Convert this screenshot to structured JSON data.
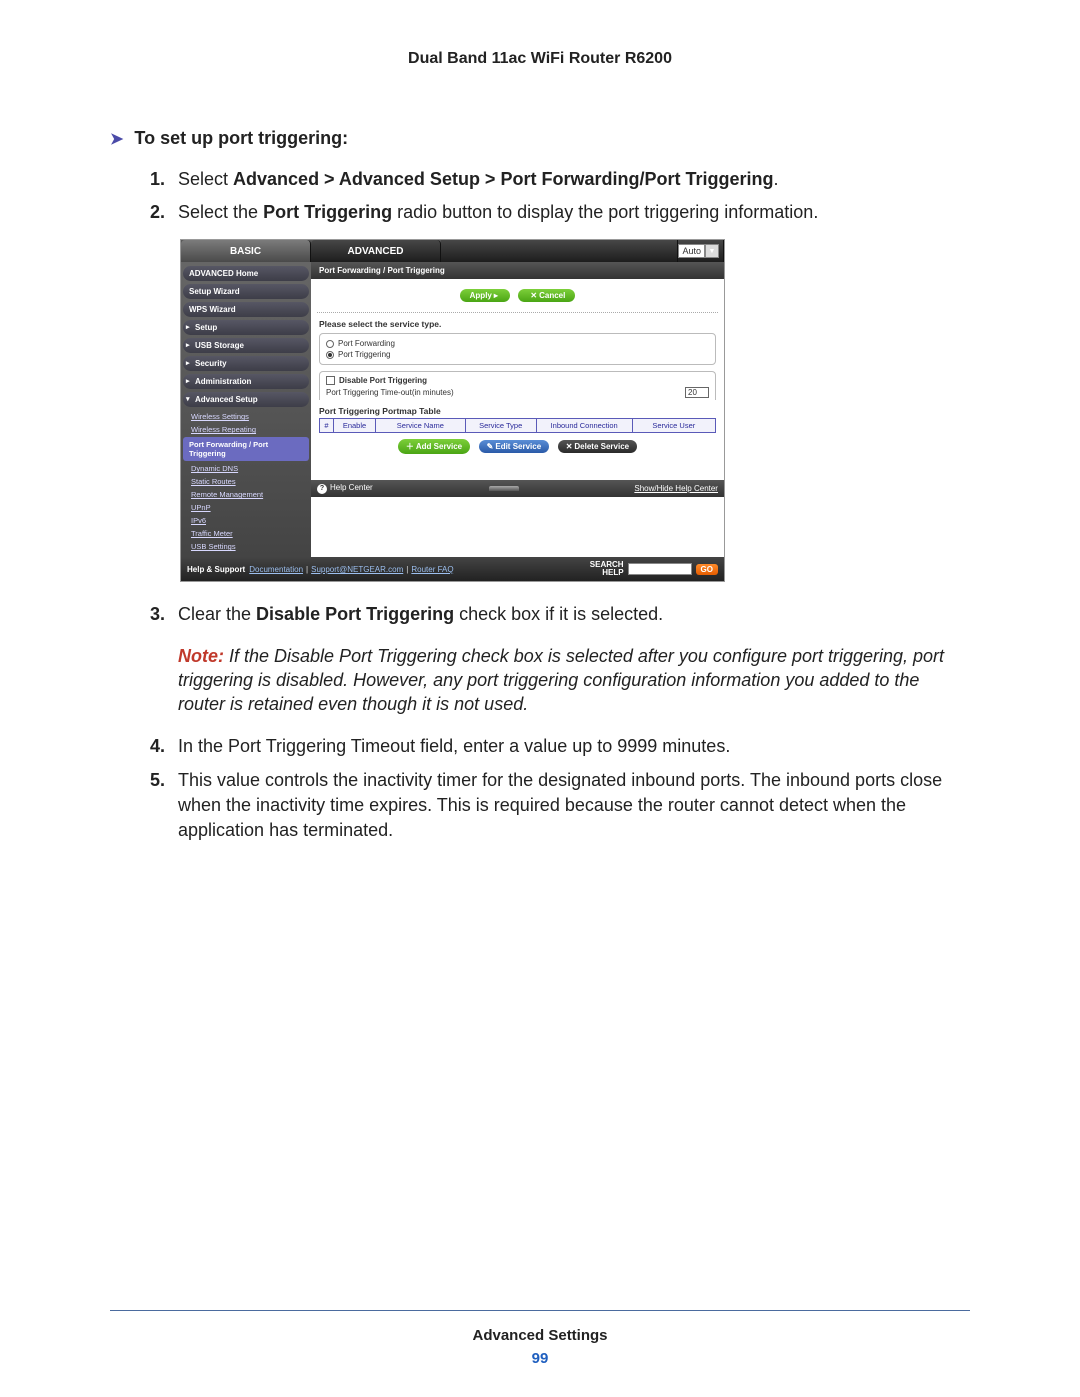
{
  "doc_header": "Dual Band 11ac WiFi Router R6200",
  "section_title": "To set up port triggering:",
  "steps": {
    "s1": {
      "num": "1.",
      "pre": "Select ",
      "bold": "Advanced > Advanced Setup > Port Forwarding/Port Triggering",
      "post": "."
    },
    "s2": {
      "num": "2.",
      "pre": "Select the ",
      "bold": "Port Triggering",
      "post": " radio button to display the port triggering information."
    },
    "s3": {
      "num": "3.",
      "pre": "Clear the ",
      "bold": "Disable Port Triggering",
      "post": " check box if it is selected."
    },
    "s4": {
      "num": "4.",
      "text": "In the Port Triggering Timeout field, enter a value up to 9999 minutes."
    },
    "s5": {
      "num": "5.",
      "text": "This value controls the inactivity timer for the designated inbound ports. The inbound ports close when the inactivity time expires. This is required because the router cannot detect when the application has terminated."
    }
  },
  "note": {
    "label": "Note:",
    "body": "  If the Disable Port Triggering check box is selected after you configure port triggering, port triggering is disabled. However, any port triggering configuration information you added to the router is retained even though it is not used."
  },
  "shot": {
    "tabs": {
      "basic": "BASIC",
      "advanced": "ADVANCED",
      "auto": "Auto"
    },
    "sidebar": {
      "adv_home": "ADVANCED Home",
      "setup_wiz": "Setup Wizard",
      "wps_wiz": "WPS Wizard",
      "setup": "Setup",
      "usb": "USB Storage",
      "security": "Security",
      "admin": "Administration",
      "adv_setup": "Advanced Setup",
      "subs": {
        "ws": "Wireless Settings",
        "wr": "Wireless Repeating",
        "pf": "Port Forwarding / Port Triggering",
        "dd": "Dynamic DNS",
        "sr": "Static Routes",
        "rm": "Remote Management",
        "upnp": "UPnP",
        "ipv6": "IPv6",
        "tm": "Traffic Meter",
        "usbs": "USB Settings"
      }
    },
    "main": {
      "crumb": "Port Forwarding / Port Triggering",
      "apply": "Apply",
      "cancel": "Cancel",
      "svc_label": "Please select the service type.",
      "r_pf": "Port Forwarding",
      "r_pt": "Port Triggering",
      "disable_pt": "Disable Port Triggering",
      "timeout_lbl": "Port Triggering Time-out(in minutes)",
      "timeout_val": "20",
      "tbl_title": "Port Triggering Portmap Table",
      "th": {
        "hash": "#",
        "enable": "Enable",
        "sname": "Service Name",
        "stype": "Service Type",
        "inbound": "Inbound Connection",
        "suser": "Service User"
      },
      "b_add": "Add Service",
      "b_edit": "Edit Service",
      "b_del": "Delete Service",
      "helpcenter": "Help Center",
      "showhide": "Show/Hide Help Center"
    },
    "footer": {
      "help_support": "Help & Support",
      "documentation": "Documentation",
      "support": "Support@NETGEAR.com",
      "rfaq": "Router FAQ",
      "search_lbl_1": "SEARCH",
      "search_lbl_2": "HELP",
      "go": "GO"
    }
  },
  "footer": {
    "title": "Advanced Settings",
    "page": "99"
  }
}
